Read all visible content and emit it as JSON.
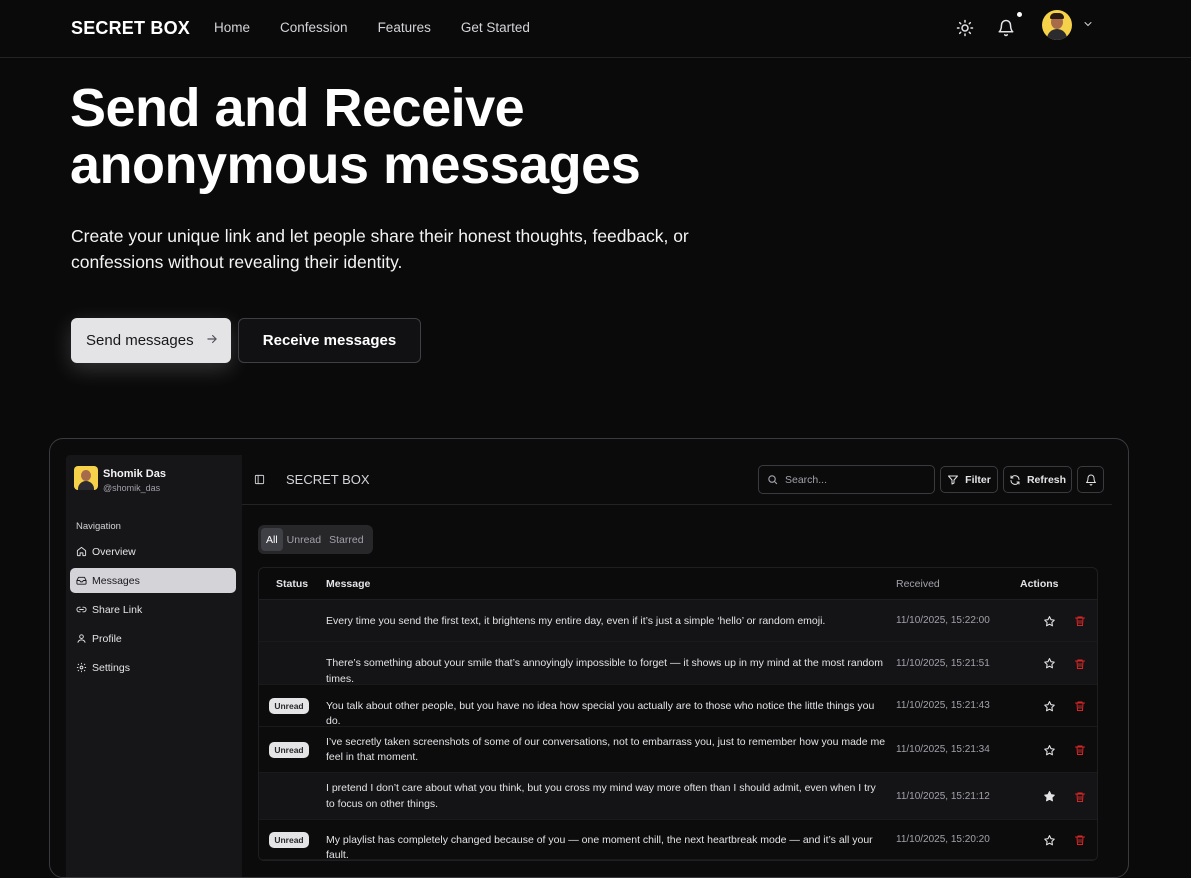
{
  "header": {
    "brand": "SECRET BOX",
    "nav": [
      "Home",
      "Confession",
      "Features",
      "Get Started"
    ],
    "icons": [
      "sun-icon",
      "bell-icon",
      "avatar",
      "chevron-down-icon"
    ]
  },
  "hero": {
    "title_line1": "Send and Receive",
    "title_line2": "anonymous messages",
    "subtitle": "Create your unique link and let people share their honest thoughts, feedback, or confessions without revealing their identity.",
    "send_button": "Send messages",
    "receive_button": "Receive messages"
  },
  "dashboard": {
    "user": {
      "name": "Shomik Das",
      "handle": "@shomik_das"
    },
    "nav_label": "Navigation",
    "nav_items": [
      "Overview",
      "Messages",
      "Share Link",
      "Profile",
      "Settings"
    ],
    "active_nav": "Messages",
    "brand": "SECRET BOX",
    "search_placeholder": "Search...",
    "filter_label": "Filter",
    "refresh_label": "Refresh",
    "tabs": [
      "All",
      "Unread",
      "Starred"
    ],
    "active_tab": "All",
    "columns": [
      "Status",
      "Message",
      "Received",
      "Actions"
    ],
    "unread_badge": "Unread",
    "messages": [
      {
        "unread": false,
        "starred": false,
        "text": "Every time you send the first text, it brightens my entire day, even if it’s just a simple ‘hello’ or random emoji.",
        "received": "11/10/2025, 15:22:00"
      },
      {
        "unread": false,
        "starred": false,
        "text": "There’s something about your smile that’s annoyingly impossible to forget — it shows up in my mind at the most random times.",
        "received": "11/10/2025, 15:21:51"
      },
      {
        "unread": true,
        "starred": false,
        "text": "You talk about other people, but you have no idea how special you actually are to those who notice the little things you do.",
        "received": "11/10/2025, 15:21:43"
      },
      {
        "unread": true,
        "starred": false,
        "text": "I’ve secretly taken screenshots of some of our conversations, not to embarrass you, just to remember how you made me feel in that moment.",
        "received": "11/10/2025, 15:21:34"
      },
      {
        "unread": false,
        "starred": true,
        "text": "I pretend I don’t care about what you think, but you cross my mind way more often than I should admit, even when I try to focus on other things.",
        "received": "11/10/2025, 15:21:12"
      },
      {
        "unread": true,
        "starred": false,
        "text": "My playlist has completely changed because of you — one moment chill, the next heartbreak mode — and it’s all your fault.",
        "received": "11/10/2025, 15:20:20"
      }
    ]
  }
}
